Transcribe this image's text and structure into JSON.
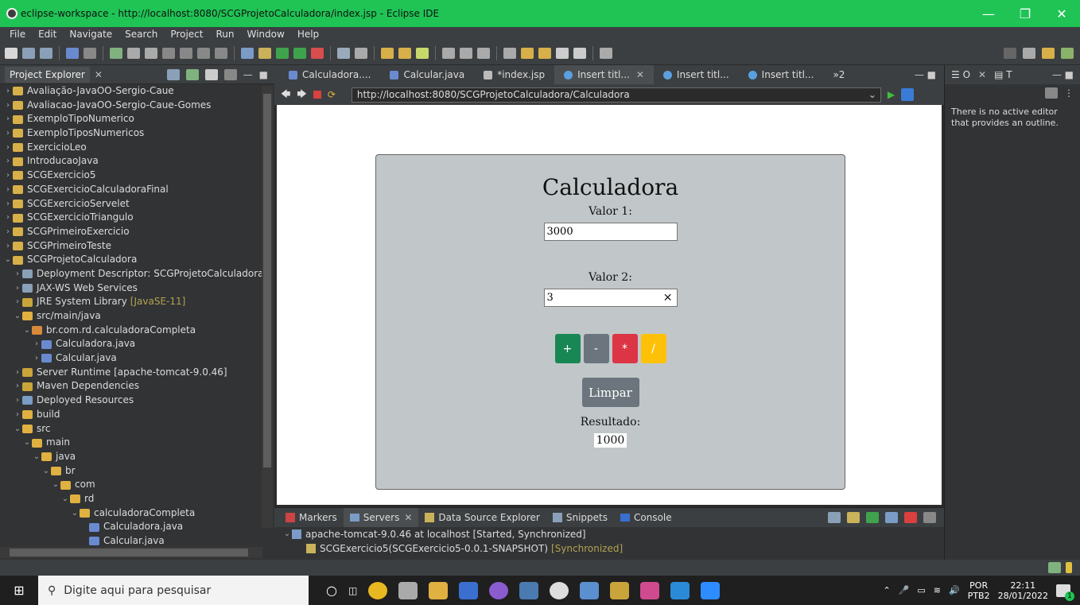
{
  "window": {
    "title": "eclipse-workspace - http://localhost:8080/SCGProjetoCalculadora/index.jsp - Eclipse IDE"
  },
  "menu": [
    "File",
    "Edit",
    "Navigate",
    "Search",
    "Project",
    "Run",
    "Window",
    "Help"
  ],
  "explorer": {
    "tab_label": "Project Explorer",
    "items": [
      {
        "label": "Avaliação-JavaOO-Sergio-Caue",
        "indent": 0,
        "open": false,
        "icon": "project"
      },
      {
        "label": "Avaliacao-JavaOO-Sergio-Caue-Gomes",
        "indent": 0,
        "open": false,
        "icon": "project"
      },
      {
        "label": "ExemploTipoNumerico",
        "indent": 0,
        "open": false,
        "icon": "project"
      },
      {
        "label": "ExemploTiposNumericos",
        "indent": 0,
        "open": false,
        "icon": "project"
      },
      {
        "label": "ExercicioLeo",
        "indent": 0,
        "open": false,
        "icon": "project"
      },
      {
        "label": "IntroducaoJava",
        "indent": 0,
        "open": false,
        "icon": "project"
      },
      {
        "label": "SCGExercicio5",
        "indent": 0,
        "open": false,
        "icon": "web"
      },
      {
        "label": "SCGExercicioCalculadoraFinal",
        "indent": 0,
        "open": false,
        "icon": "web"
      },
      {
        "label": "SCGExercicioServelet",
        "indent": 0,
        "open": false,
        "icon": "web"
      },
      {
        "label": "SCGExercicioTriangulo",
        "indent": 0,
        "open": false,
        "icon": "web"
      },
      {
        "label": "SCGPrimeiroExercicio",
        "indent": 0,
        "open": false,
        "icon": "web"
      },
      {
        "label": "SCGPrimeiroTeste",
        "indent": 0,
        "open": false,
        "icon": "web"
      },
      {
        "label": "SCGProjetoCalculadora",
        "indent": 0,
        "open": true,
        "icon": "web"
      },
      {
        "label": "Deployment Descriptor: SCGProjetoCalculadora",
        "indent": 1,
        "open": false,
        "icon": "descriptor"
      },
      {
        "label": "JAX-WS Web Services",
        "indent": 1,
        "open": false,
        "icon": "ws"
      },
      {
        "label": "JRE System Library",
        "deco": "[JavaSE-11]",
        "indent": 1,
        "open": false,
        "icon": "lib"
      },
      {
        "label": "src/main/java",
        "indent": 1,
        "open": true,
        "icon": "srcfolder"
      },
      {
        "label": "br.com.rd.calculadoraCompleta",
        "indent": 2,
        "open": true,
        "icon": "package"
      },
      {
        "label": "Calculadora.java",
        "indent": 3,
        "open": false,
        "icon": "java"
      },
      {
        "label": "Calcular.java",
        "indent": 3,
        "open": false,
        "icon": "java"
      },
      {
        "label": "Server Runtime [apache-tomcat-9.0.46]",
        "indent": 1,
        "open": false,
        "icon": "lib"
      },
      {
        "label": "Maven Dependencies",
        "indent": 1,
        "open": false,
        "icon": "lib"
      },
      {
        "label": "Deployed Resources",
        "indent": 1,
        "open": false,
        "icon": "deployed"
      },
      {
        "label": "build",
        "indent": 1,
        "open": false,
        "icon": "folder"
      },
      {
        "label": "src",
        "indent": 1,
        "open": true,
        "icon": "folder"
      },
      {
        "label": "main",
        "indent": 2,
        "open": true,
        "icon": "folder"
      },
      {
        "label": "java",
        "indent": 3,
        "open": true,
        "icon": "folder"
      },
      {
        "label": "br",
        "indent": 4,
        "open": true,
        "icon": "folder"
      },
      {
        "label": "com",
        "indent": 5,
        "open": true,
        "icon": "folder"
      },
      {
        "label": "rd",
        "indent": 6,
        "open": true,
        "icon": "folder"
      },
      {
        "label": "calculadoraCompleta",
        "indent": 7,
        "open": true,
        "icon": "folder"
      },
      {
        "label": "Calculadora.java",
        "indent": 8,
        "open": null,
        "icon": "java"
      },
      {
        "label": "Calcular.java",
        "indent": 8,
        "open": null,
        "icon": "java"
      }
    ]
  },
  "editor": {
    "tabs": [
      {
        "label": "Calculadora....",
        "icon": "java",
        "active": false
      },
      {
        "label": "Calcular.java",
        "icon": "java",
        "active": false
      },
      {
        "label": "*index.jsp",
        "icon": "jsp",
        "active": false
      },
      {
        "label": "Insert titl...",
        "icon": "globe",
        "active": true
      },
      {
        "label": "Insert titl...",
        "icon": "globe",
        "active": false
      },
      {
        "label": "Insert titl...",
        "icon": "globe",
        "active": false
      }
    ],
    "overflow_count": "»2",
    "url": "http://localhost:8080/SCGProjetoCalculadora/Calculadora"
  },
  "calc": {
    "title": "Calculadora",
    "label1": "Valor 1:",
    "value1": "3000",
    "label2": "Valor 2:",
    "value2": "3",
    "ops": [
      {
        "symbol": "+",
        "color": "#198754"
      },
      {
        "symbol": "-",
        "color": "#6c757d"
      },
      {
        "symbol": "*",
        "color": "#dc3545"
      },
      {
        "symbol": "/",
        "color": "#ffc107"
      }
    ],
    "clear_label": "Limpar",
    "result_label": "Resultado:",
    "result_value": "1000"
  },
  "outline": {
    "message": "There is no active editor that provides an outline."
  },
  "bottom": {
    "tabs": [
      "Markers",
      "Servers",
      "Data Source Explorer",
      "Snippets",
      "Console"
    ],
    "server_line": "apache-tomcat-9.0.46 at localhost  [Started, Synchronized]",
    "module_line": "SCGExercicio5(SCGExercicio5-0.0.1-SNAPSHOT)",
    "module_status": "[Synchronized]"
  },
  "taskbar": {
    "search_placeholder": "Digite aqui para pesquisar",
    "lang_top": "POR",
    "lang_bottom": "PTB2",
    "time": "22:11",
    "date": "28/01/2022",
    "notif_count": "1"
  }
}
